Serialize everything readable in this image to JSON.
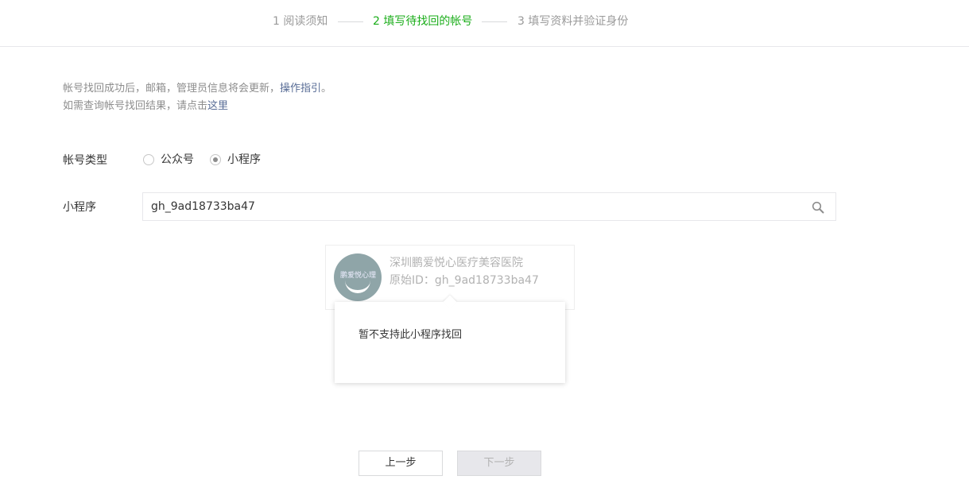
{
  "steps": [
    {
      "label": "1 阅读须知",
      "active": false
    },
    {
      "label": "2 填写待找回的帐号",
      "active": true
    },
    {
      "label": "3 填写资料并验证身份",
      "active": false
    }
  ],
  "info": {
    "line1_text": "帐号找回成功后，邮箱，管理员信息将会更新，",
    "line1_link": "操作指引",
    "line1_end": "。",
    "line2_text": "如需查询帐号找回结果，请点击",
    "line2_link": "这里"
  },
  "account_type": {
    "label": "帐号类型",
    "options": [
      "公众号",
      "小程序"
    ],
    "selected": "小程序"
  },
  "mini_program": {
    "label": "小程序",
    "value": "gh_9ad18733ba47"
  },
  "result_card": {
    "avatar_text": "鹏爱悦心理",
    "name": "深圳鹏爱悦心医疗美容医院",
    "id_line": "原始ID：gh_9ad18733ba47"
  },
  "popover": {
    "message": "暂不支持此小程序找回"
  },
  "buttons": {
    "prev": "上一步",
    "next": "下一步"
  },
  "colors": {
    "accent": "#1aad19",
    "link": "#576b95",
    "muted": "#9a9a9a"
  }
}
